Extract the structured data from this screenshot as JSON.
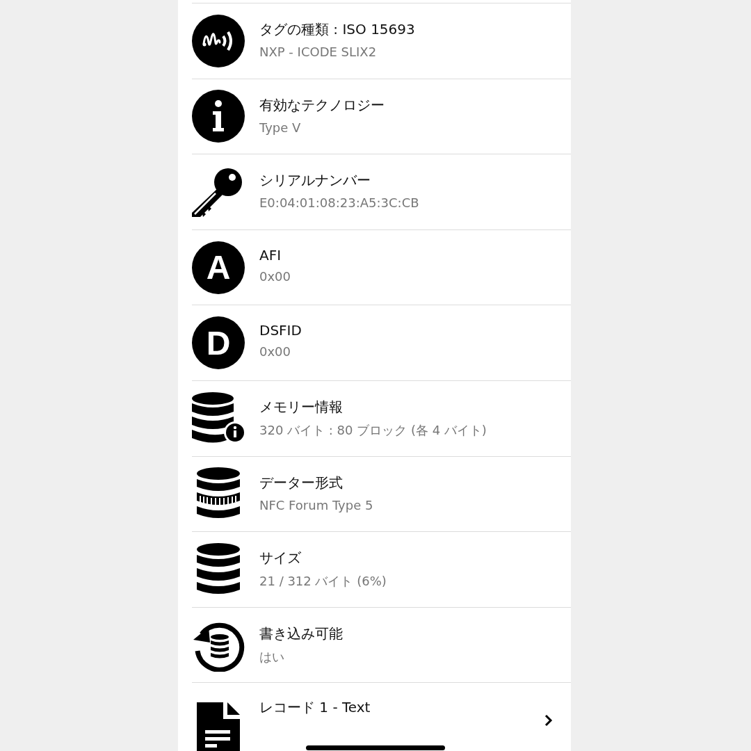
{
  "rows": [
    {
      "kind": "nfc",
      "title": "タグの種類 : ISO 15693",
      "value": "NXP - ICODE SLIX2",
      "navigable": false
    },
    {
      "kind": "info",
      "title": "有効なテクノロジー",
      "value": "Type V",
      "navigable": false
    },
    {
      "kind": "key",
      "title": "シリアルナンバー",
      "value": "E0:04:01:08:23:A5:3C:CB",
      "navigable": false
    },
    {
      "kind": "letter",
      "letter": "A",
      "title": "AFI",
      "value": "0x00",
      "navigable": false
    },
    {
      "kind": "letter",
      "letter": "D",
      "title": "DSFID",
      "value": "0x00",
      "navigable": false
    },
    {
      "kind": "database-info",
      "title": "メモリー情報",
      "value": "320 バイト : 80 ブロック (各 4 バイト)",
      "navigable": false
    },
    {
      "kind": "database-striped",
      "title": "データー形式",
      "value": "NFC Forum Type 5",
      "navigable": false
    },
    {
      "kind": "database",
      "title": "サイズ",
      "value": "21 / 312 バイト (6%)",
      "navigable": false
    },
    {
      "kind": "database-refresh",
      "title": "書き込み可能",
      "value": "はい",
      "navigable": false
    },
    {
      "kind": "document",
      "title": "レコード 1 - Text",
      "navigable": true
    }
  ]
}
